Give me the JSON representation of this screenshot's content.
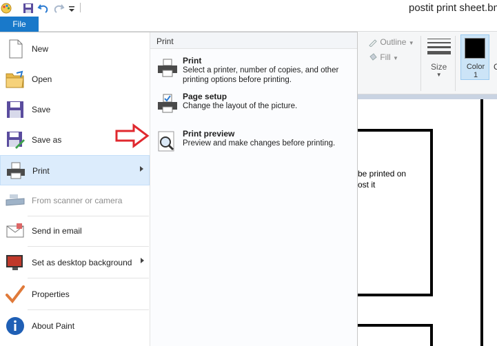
{
  "window": {
    "title": "postit print sheet.bmp"
  },
  "ribbon": {
    "file_tab": "File",
    "outline_label": "Outline",
    "fill_label": "Fill",
    "size_label": "Size",
    "color1_line1": "Color",
    "color1_line2": "1",
    "color2_partial": "C",
    "colors": {
      "accent": "#1979ca",
      "ribbon_bg": "#f5f6f7",
      "hover": "#dcecfc"
    }
  },
  "canvas": {
    "text_line1": "be printed on",
    "text_line2": "ost it"
  },
  "file_menu": {
    "items": [
      {
        "label": "New",
        "icon": "new-document-icon"
      },
      {
        "label": "Open",
        "icon": "open-folder-icon"
      },
      {
        "label": "Save",
        "icon": "save-disk-icon"
      },
      {
        "label": "Save as",
        "icon": "save-as-icon"
      },
      {
        "label": "Print",
        "icon": "printer-icon"
      },
      {
        "label": "From scanner or camera",
        "icon": "scanner-icon"
      },
      {
        "label": "Send in email",
        "icon": "email-icon"
      },
      {
        "label": "Set as desktop background",
        "icon": "desktop-background-icon"
      },
      {
        "label": "Properties",
        "icon": "checkmark-icon"
      },
      {
        "label": "About Paint",
        "icon": "info-icon"
      }
    ]
  },
  "print_submenu": {
    "header": "Print",
    "items": [
      {
        "title": "Print",
        "description": "Select a printer, number of copies, and other printing options before printing.",
        "icon": "printer-icon"
      },
      {
        "title": "Page setup",
        "description": "Change the layout of the picture.",
        "icon": "page-setup-icon"
      },
      {
        "title": "Print preview",
        "description": "Preview and make changes before printing.",
        "icon": "magnifier-icon"
      }
    ]
  }
}
